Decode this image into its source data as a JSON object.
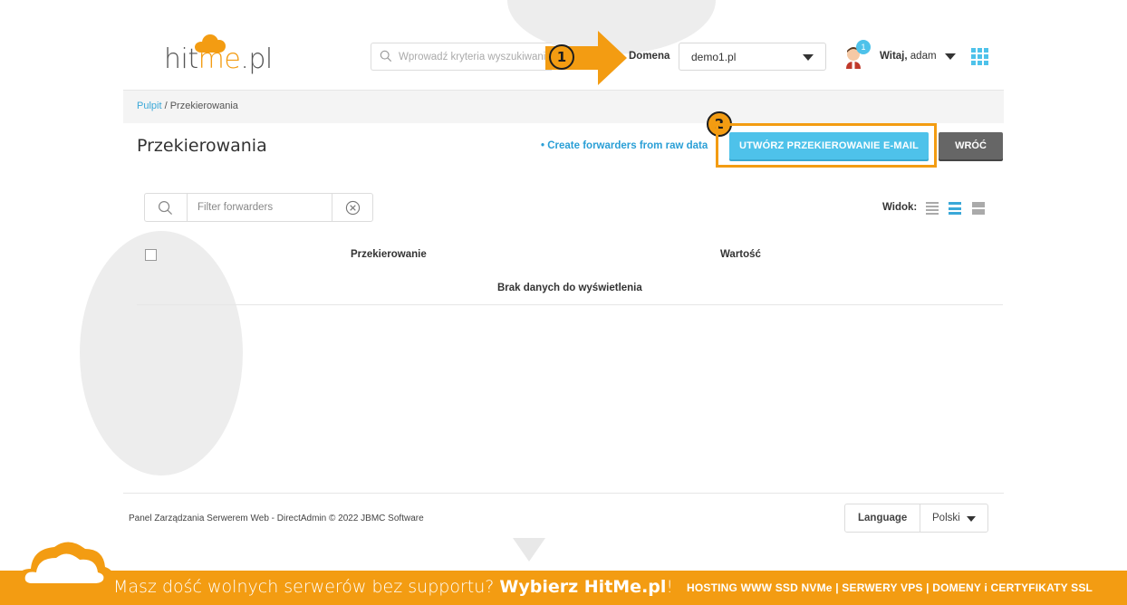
{
  "brand": {
    "logo_text_pre": "hit",
    "logo_text_accent": "me",
    "logo_text_post": ".pl"
  },
  "header": {
    "search_placeholder": "Wprowadź kryteria wyszukiwania",
    "domain_label": "Domena",
    "domain_value": "demo1.pl",
    "notification_count": "1",
    "greet_prefix": "Witaj,",
    "user_name": "adam"
  },
  "annotations": {
    "step1": "1",
    "step2": "2",
    "accent_color": "#f39c12"
  },
  "breadcrumb": {
    "root": "Pulpit",
    "separator": " / ",
    "current": "Przekierowania"
  },
  "page": {
    "title": "Przekierowania",
    "raw_link": "• Create forwarders from raw data",
    "create_button": "UTWÓRZ PRZEKIEROWANIE E-MAIL",
    "back_button": "WRÓĆ"
  },
  "filter": {
    "placeholder": "Filter forwarders"
  },
  "view": {
    "label": "Widok:"
  },
  "table": {
    "columns": [
      "Przekierowanie",
      "Wartość"
    ],
    "empty_message": "Brak danych do wyświetlenia"
  },
  "footer": {
    "copyright": "Panel Zarządzania Serwerem Web - DirectAdmin © 2022 JBMC Software",
    "language_label": "Language",
    "language_value": "Polski"
  },
  "promo": {
    "left_text": "Masz dość wolnych serwerów bez supportu? ",
    "left_bold": "Wybierz HitMe.pl",
    "left_end": "!",
    "right_text": "HOSTING WWW SSD NVMe | SERWERY VPS | DOMENY i CERTYFIKATY SSL"
  },
  "colors": {
    "primary_blue": "#4ec2ea",
    "link_blue": "#2a9fd6",
    "orange": "#f39c12",
    "dark_button": "#666666"
  }
}
